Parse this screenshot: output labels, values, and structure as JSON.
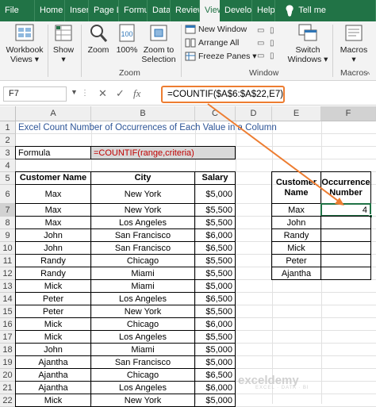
{
  "ribbon_tabs": [
    {
      "label": "File",
      "active": false
    },
    {
      "label": "Home",
      "active": false
    },
    {
      "label": "Insert",
      "active": false
    },
    {
      "label": "Page La",
      "active": false
    },
    {
      "label": "Formul",
      "active": false
    },
    {
      "label": "Data",
      "active": false
    },
    {
      "label": "Review",
      "active": false
    },
    {
      "label": "View",
      "active": true
    },
    {
      "label": "Develo",
      "active": false
    },
    {
      "label": "Help",
      "active": false
    },
    {
      "label": "Tell me",
      "active": false
    }
  ],
  "ribbon": {
    "workbook_views": "Workbook\nViews ▾",
    "show": "Show\n▾",
    "zoom": "Zoom",
    "zoom_100": "100%",
    "zoom_to_selection": "Zoom to\nSelection",
    "zoom_group": "Zoom",
    "new_window": "New Window",
    "arrange_all": "Arrange All",
    "freeze_panes": "Freeze Panes ▾",
    "switch_windows": "Switch\nWindows ▾",
    "window_group": "Window",
    "macros": "Macros\n▾",
    "macros_group": "Macros"
  },
  "formula_bar": {
    "name_box": "F7",
    "formula": "=COUNTIF($A$6:$A$22,E7)",
    "cancel_symbol": "✕",
    "enter_symbol": "✓",
    "fx_symbol": "fx"
  },
  "sheet": {
    "columns": [
      "A",
      "B",
      "C",
      "D",
      "E",
      "F"
    ],
    "rows": [
      "1",
      "2",
      "3",
      "4",
      "5",
      "6",
      "7",
      "8",
      "9",
      "10",
      "11",
      "12",
      "13",
      "14",
      "15",
      "16",
      "17",
      "18",
      "19",
      "20",
      "21",
      "22"
    ],
    "title": "Excel Count Number of Occurrences of Each Value in a Column",
    "formula_label": "Formula",
    "formula_text": "=COUNTIF(range,criteria)",
    "headers": {
      "customer_name": "Customer Name",
      "city": "City",
      "salary": "Salary"
    },
    "data_rows": [
      {
        "row": "6",
        "name": "Max",
        "city": "New York",
        "salary": "$5,000"
      },
      {
        "row": "7",
        "name": "Max",
        "city": "New York",
        "salary": "$5,500"
      },
      {
        "row": "8",
        "name": "Max",
        "city": "Los Angeles",
        "salary": "$5,500"
      },
      {
        "row": "9",
        "name": "John",
        "city": "San Francisco",
        "salary": "$6,000"
      },
      {
        "row": "10",
        "name": "John",
        "city": "San Francisco",
        "salary": "$6,500"
      },
      {
        "row": "11",
        "name": "Randy",
        "city": "Chicago",
        "salary": "$5,500"
      },
      {
        "row": "12",
        "name": "Randy",
        "city": "Miami",
        "salary": "$5,500"
      },
      {
        "row": "13",
        "name": "Mick",
        "city": "Miami",
        "salary": "$5,000"
      },
      {
        "row": "14",
        "name": "Peter",
        "city": "Los Angeles",
        "salary": "$6,500"
      },
      {
        "row": "15",
        "name": "Peter",
        "city": "New York",
        "salary": "$5,500"
      },
      {
        "row": "16",
        "name": "Mick",
        "city": "Chicago",
        "salary": "$6,000"
      },
      {
        "row": "17",
        "name": "Mick",
        "city": "Los Angeles",
        "salary": "$5,500"
      },
      {
        "row": "18",
        "name": "John",
        "city": "Miami",
        "salary": "$5,000"
      },
      {
        "row": "19",
        "name": "Ajantha",
        "city": "San Francisco",
        "salary": "$5,000"
      },
      {
        "row": "20",
        "name": "Ajantha",
        "city": "Chicago",
        "salary": "$6,500"
      },
      {
        "row": "21",
        "name": "Ajantha",
        "city": "Los Angeles",
        "salary": "$6,000"
      },
      {
        "row": "22",
        "name": "Mick",
        "city": "New York",
        "salary": "$5,000"
      }
    ],
    "occurrence_headers": {
      "customer_name": "Customer\nName",
      "occurrence_number": "Occurrence\nNumber"
    },
    "occurrence_rows": [
      {
        "name": "Max",
        "count": "4"
      },
      {
        "name": "John",
        "count": ""
      },
      {
        "name": "Randy",
        "count": ""
      },
      {
        "name": "Mick",
        "count": ""
      },
      {
        "name": "Peter",
        "count": ""
      },
      {
        "name": "Ajantha",
        "count": ""
      }
    ],
    "watermark": "exceldemy",
    "watermark_sub": "EXCEL · DATA · BI"
  },
  "colors": {
    "excel_green": "#217346",
    "formula_highlight": "#ed7d31",
    "title_blue": "#2e5597",
    "formula_red": "#c00000"
  }
}
